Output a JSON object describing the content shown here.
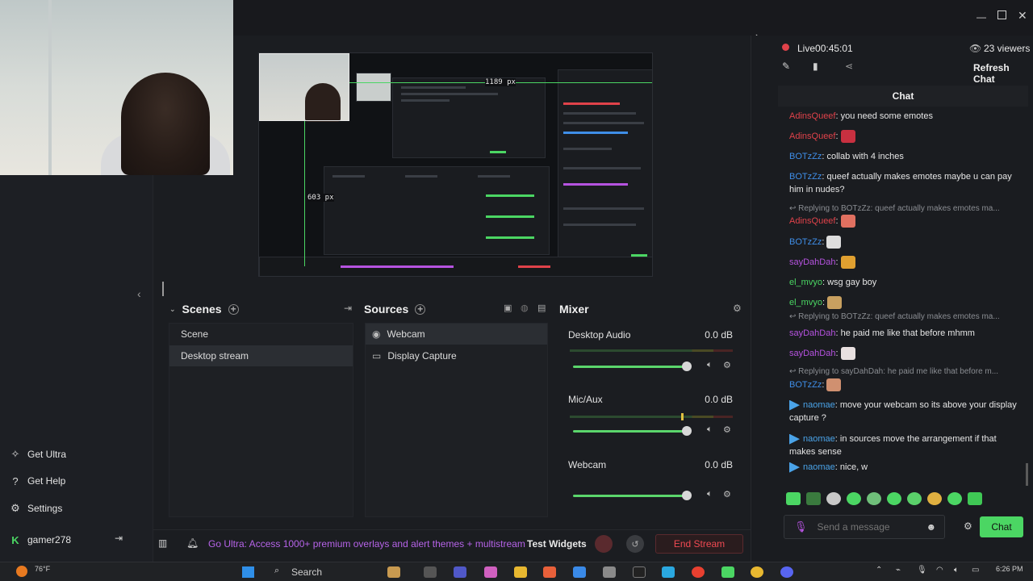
{
  "sidebar": {
    "items": [
      {
        "label": "Get Ultra",
        "icon": "sparkle-icon"
      },
      {
        "label": "Get Help",
        "icon": "help-icon"
      },
      {
        "label": "Settings",
        "icon": "gear-icon"
      }
    ],
    "user": {
      "name": "gamer278"
    }
  },
  "preview": {
    "width_label": "1189 px",
    "height_label": "603 px"
  },
  "docks": {
    "scenes": {
      "title": "Scenes",
      "items": [
        "Scene",
        "Desktop stream"
      ],
      "selected": 1
    },
    "sources": {
      "title": "Sources",
      "items": [
        "Webcam",
        "Display Capture"
      ],
      "selected": 0
    },
    "mixer": {
      "title": "Mixer",
      "channels": [
        {
          "name": "Desktop Audio",
          "db": "0.0 dB",
          "level": 1.0
        },
        {
          "name": "Mic/Aux",
          "db": "0.0 dB",
          "level": 1.0
        },
        {
          "name": "Webcam",
          "db": "0.0 dB",
          "level": 1.0
        }
      ]
    }
  },
  "bottombar": {
    "promo": "Go Ultra: Access 1000+ premium overlays and alert themes + multistream",
    "test_widgets": "Test Widgets",
    "end_stream": "End Stream"
  },
  "chat": {
    "live_label": "Live",
    "live_time": "00:45:01",
    "viewers": "23 viewers",
    "refresh": "Refresh Chat",
    "title": "Chat",
    "messages": [
      {
        "user": "AdinsQueef",
        "text": "you need some emotes",
        "color": "#e0424a"
      },
      {
        "user": "AdinsQueef",
        "text": "",
        "color": "#e0424a"
      },
      {
        "user": "BOTzZz",
        "text": "collab with 4 inches",
        "color": "#3f8ee8"
      },
      {
        "user": "BOTzZz",
        "text": "queef actually makes emotes maybe u can pay him in nudes?",
        "color": "#3f8ee8"
      },
      {
        "reply": "Replying to BOTzZz: queef actually makes emotes ma..."
      },
      {
        "user": "AdinsQueef",
        "text": "",
        "color": "#e0424a"
      },
      {
        "user": "BOTzZz",
        "text": "",
        "color": "#3f8ee8"
      },
      {
        "user": "sayDahDah",
        "text": "",
        "color": "#b653e0"
      },
      {
        "user": "el_mvyo",
        "text": "wsg gay boy",
        "color": "#4bd663"
      },
      {
        "user": "el_mvyo",
        "text": "",
        "color": "#4bd663"
      },
      {
        "reply": "Replying to BOTzZz: queef actually makes emotes ma..."
      },
      {
        "user": "sayDahDah",
        "text": "he paid me like that before mhmm",
        "color": "#b653e0"
      },
      {
        "user": "sayDahDah",
        "text": "",
        "color": "#b653e0"
      },
      {
        "reply": "Replying to sayDahDah: he paid me like that before m..."
      },
      {
        "user": "BOTzZz",
        "text": "",
        "color": "#3f8ee8"
      },
      {
        "user": "naomae",
        "text": "move your webcam so its above your display capture ?",
        "color": "#4aa3e8"
      },
      {
        "user": "naomae",
        "text": "in sources move the arrangement if that makes sense",
        "color": "#4aa3e8"
      },
      {
        "user": "naomae",
        "text": "nice, w",
        "color": "#4aa3e8"
      }
    ],
    "input_placeholder": "Send a message",
    "send_label": "Chat"
  },
  "taskbar": {
    "weather": "76°F",
    "search": "Search",
    "time": "6:26 PM"
  },
  "colors": {
    "accent": "#4bd663",
    "danger": "#e0424a"
  }
}
